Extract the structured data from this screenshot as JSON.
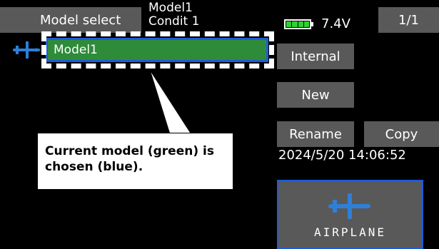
{
  "header": {
    "title": "Model select",
    "model_name": "Model1",
    "condition": "Condit 1",
    "battery_voltage": "7.4V",
    "battery_level": 1.0,
    "page": "1/1"
  },
  "model_list": {
    "items": [
      {
        "name": "Model1",
        "type_icon": "airplane-icon",
        "current": true,
        "selected": true
      }
    ]
  },
  "buttons": {
    "internal": "Internal",
    "new": "New",
    "rename": "Rename",
    "copy": "Copy"
  },
  "datetime": "2024/5/20 14:06:52",
  "model_type": {
    "label": "AIRPLANE",
    "icon": "airplane-icon"
  },
  "callout": {
    "text": "Current model (green) is chosen (blue)."
  },
  "colors": {
    "current_model_fill": "#2e8b3a",
    "selection_border": "#1e5bd6",
    "button_bg": "#595959",
    "icon": "#2f7fd6",
    "battery": "#2fd12f"
  }
}
